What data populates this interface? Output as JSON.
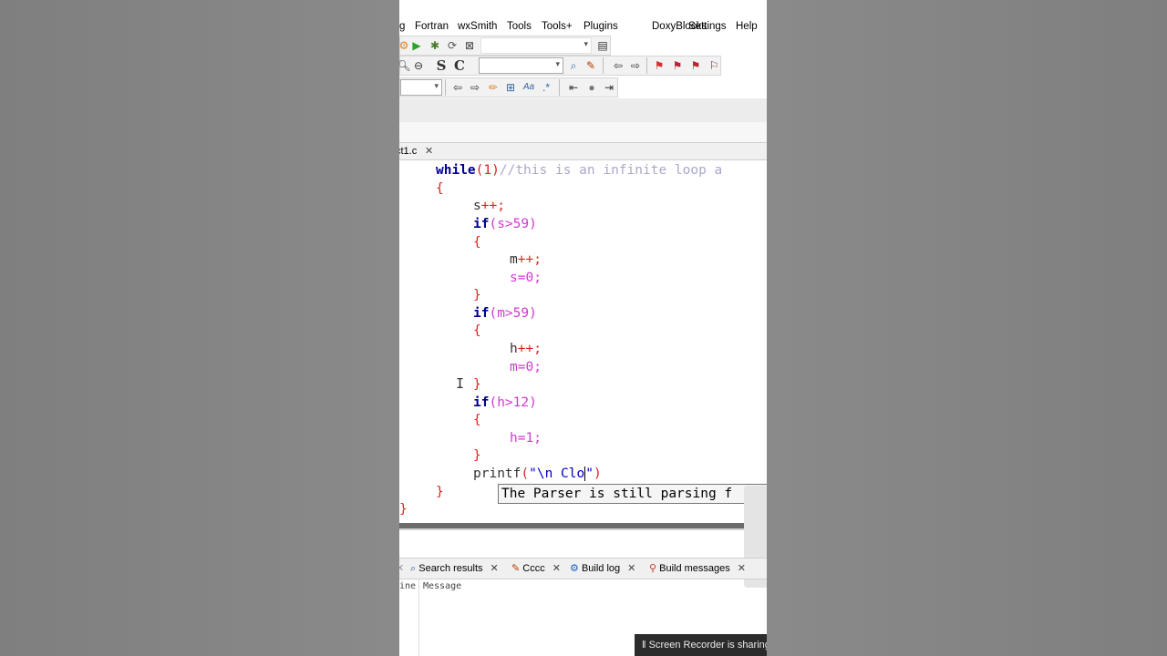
{
  "menu": [
    "g",
    "Fortran",
    "wxSmith",
    "Tools",
    "Tools+",
    "Plugins",
    "DoxyBlocks",
    "Settings",
    "Help"
  ],
  "toolbar": {
    "search_S": "S",
    "search_C": "C"
  },
  "file_tab": {
    "label": "ct1.c",
    "close": "✕"
  },
  "code": {
    "l1_kw": "while",
    "l1_rest": "(1)",
    "l1_comment": "//this is an infinite loop a",
    "brace_open": "{",
    "brace_close": "}",
    "s_inc": "s",
    "m_inc": "m",
    "h_inc": "h",
    "if_kw": "if",
    "cond1": "(s>59)",
    "cond2": "(m>59)",
    "cond3": "(h>12)",
    "s_reset": "s=0;",
    "m_reset": "m=0;",
    "h_reset": "h=1;",
    "inc_op": "++;",
    "printf_fn": "printf",
    "printf_open": "(",
    "printf_str_a": "\"\\n Clo",
    "printf_str_b": "\"",
    "printf_close": ")"
  },
  "tooltip": "The Parser is still parsing f",
  "log_tabs": [
    {
      "label": "Search results",
      "icon": "magnifier-icon"
    },
    {
      "label": "Cccc",
      "icon": "pencil-icon"
    },
    {
      "label": "Build log",
      "icon": "gear-icon"
    },
    {
      "label": "Build messages",
      "icon": "pin-icon"
    }
  ],
  "log_columns": {
    "line": "ine",
    "message": "Message"
  },
  "recorder": "Screen Recorder is sharing",
  "colors": {
    "keyword": "#00008b",
    "operator": "#dd2222",
    "number": "#d238d2",
    "comment": "#a9a9c9"
  }
}
